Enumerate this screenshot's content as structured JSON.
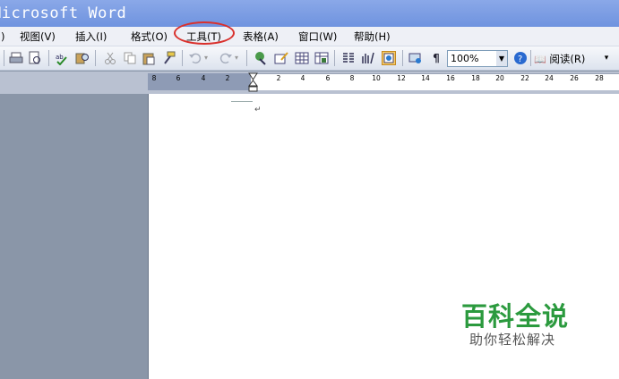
{
  "window": {
    "title": "Microsoft Word"
  },
  "menubar": {
    "items": [
      {
        "label": ")"
      },
      {
        "label": "视图(V)"
      },
      {
        "label": "插入(I)"
      },
      {
        "label": "格式(O)"
      },
      {
        "label": "工具(T)"
      },
      {
        "label": "表格(A)"
      },
      {
        "label": "窗口(W)"
      },
      {
        "label": "帮助(H)"
      }
    ]
  },
  "toolbar": {
    "zoom": "100%",
    "read_label": "阅读(R)"
  },
  "ruler": {
    "numbers": [
      "8",
      "6",
      "4",
      "2",
      "2",
      "4",
      "6",
      "8",
      "10",
      "12",
      "14",
      "16",
      "18",
      "20",
      "22",
      "24",
      "26",
      "28"
    ]
  },
  "document": {
    "paragraph_mark": "↵"
  },
  "watermark": {
    "title": "百科全说",
    "subtitle": "助你轻松解决"
  },
  "colors": {
    "highlight_circle": "#d9302c",
    "watermark_green": "#2b9a3e"
  },
  "icons": [
    "print-icon",
    "print-preview-icon",
    "spelling-icon",
    "research-icon",
    "cut-icon",
    "copy-icon",
    "paste-icon",
    "format-painter-icon",
    "undo-icon",
    "redo-icon",
    "hyperlink-icon",
    "tables-borders-icon",
    "insert-table-icon",
    "insert-excel-icon",
    "columns-icon",
    "drawing-icon",
    "document-map-icon",
    "show-hide-icon",
    "help-icon",
    "read-icon"
  ]
}
